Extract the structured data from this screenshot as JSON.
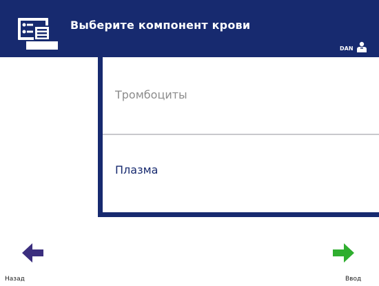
{
  "header": {
    "title": "Выберите компонент крови",
    "operator": "DAN",
    "icon": "screen-menu-icon",
    "background_color": "#172a6f"
  },
  "options": [
    {
      "label": "Тромбоциты",
      "state": "disabled",
      "text_color": "#8c8c8c"
    },
    {
      "label": "Плазма",
      "state": "enabled",
      "text_color": "#172a6f"
    }
  ],
  "navigation": {
    "back_label": "Назад",
    "back_icon": "arrow-left-icon",
    "back_color": "#3b2e7e",
    "enter_label": "Ввод",
    "enter_icon": "arrow-right-icon",
    "enter_color": "#2fae2f"
  }
}
